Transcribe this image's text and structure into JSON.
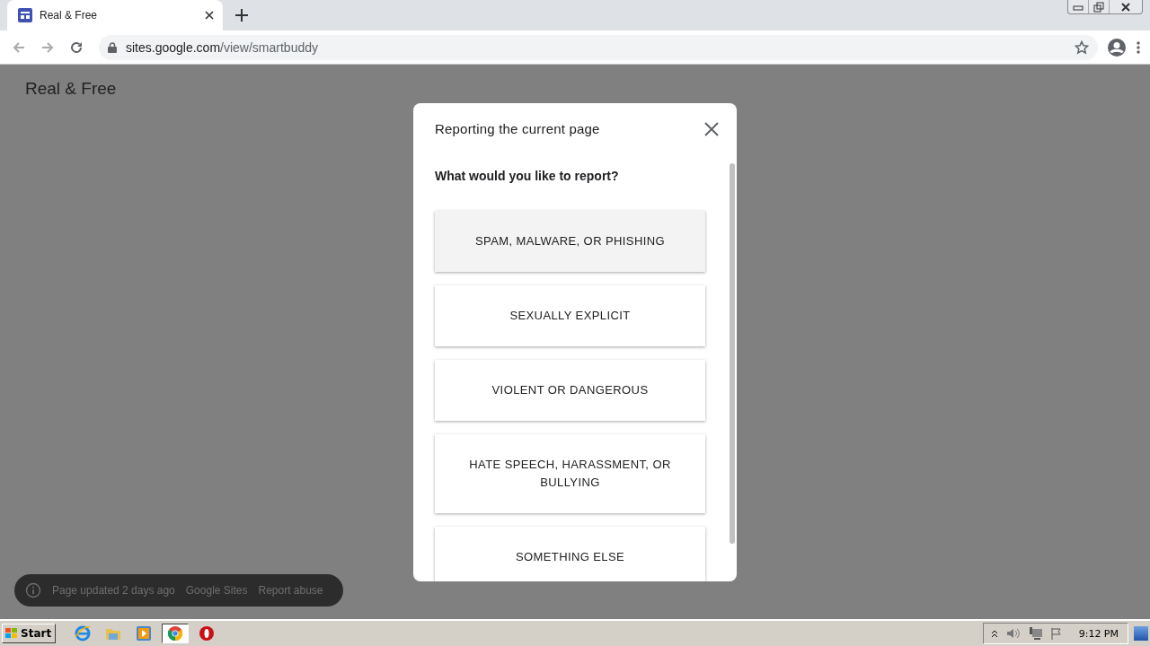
{
  "browser": {
    "tabs": [
      {
        "title": "Real & Free",
        "selected": true
      }
    ],
    "address": {
      "host": "sites.google.com",
      "path": "/view/smartbuddy"
    }
  },
  "page": {
    "site_title": "Real & Free",
    "footer": {
      "updated": "Page updated 2 days ago",
      "links": [
        "Google Sites",
        "Report abuse"
      ]
    }
  },
  "dialog": {
    "title": "Reporting the current page",
    "question": "What would you like to report?",
    "options": [
      {
        "label": "SPAM, MALWARE, OR PHISHING",
        "hovered": true
      },
      {
        "label": "SEXUALLY EXPLICIT",
        "hovered": false
      },
      {
        "label": "VIOLENT OR DANGEROUS",
        "hovered": false
      },
      {
        "label": "HATE SPEECH, HARASSMENT, OR BULLYING",
        "hovered": false
      },
      {
        "label": "SOMETHING ELSE",
        "hovered": false
      }
    ]
  },
  "taskbar": {
    "start": "Start",
    "apps": [
      {
        "kind": "ie",
        "selected": false
      },
      {
        "kind": "folder",
        "selected": false
      },
      {
        "kind": "media",
        "selected": false
      },
      {
        "kind": "chrome",
        "selected": true
      },
      {
        "kind": "opera",
        "selected": false
      }
    ],
    "clock": "9:12 PM"
  }
}
